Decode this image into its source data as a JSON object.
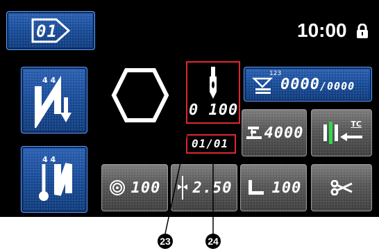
{
  "header": {
    "program_label": "01",
    "time": "10:00",
    "lock_icon": "lock-icon"
  },
  "left": {
    "top_mode_sub": "4 4",
    "bottom_mode_sub": "4 4"
  },
  "status": {
    "speed_value": "0 100",
    "step_value": "01/01"
  },
  "counter": {
    "value": "0000",
    "total": "/0000",
    "mini_label": "123"
  },
  "bobbin": {
    "value": "4000"
  },
  "tc_button": {
    "label": "TC"
  },
  "bottom": {
    "tension_value": "100",
    "pitch_value": "2.50",
    "presser_value": "100"
  },
  "callouts": {
    "c23": "23",
    "c24": "24"
  },
  "colors": {
    "highlight": "#e0262f",
    "blue": "#1a4fa0",
    "green": "#2fd84a"
  }
}
